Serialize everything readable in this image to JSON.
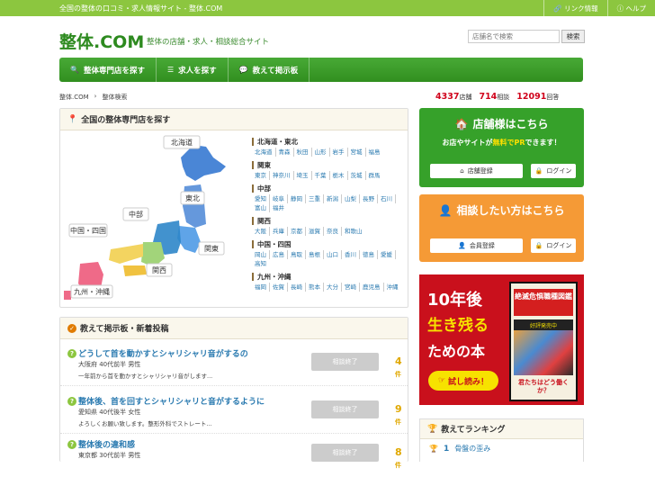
{
  "topbar": {
    "tagline": "全国の整体の口コミ・求人情報サイト - 整体.COM",
    "links": [
      {
        "icon": "link-icon",
        "label": "リンク情報"
      },
      {
        "icon": "help-icon",
        "label": "ヘルプ"
      }
    ]
  },
  "header": {
    "logo": "整体.COM",
    "subtitle": "整体の店舗・求人・相談総合サイト",
    "search_placeholder": "店舗名で検索",
    "search_button": "検索"
  },
  "nav": [
    {
      "icon": "search-icon",
      "label": "整体専門店を探す"
    },
    {
      "icon": "list-icon",
      "label": "求人を探す"
    },
    {
      "icon": "chat-icon",
      "label": "教えて掲示板"
    }
  ],
  "breadcrumb": [
    "整体.COM",
    "整体検索"
  ],
  "stats": [
    {
      "value": "4337",
      "unit": "店舗"
    },
    {
      "value": "714",
      "unit": "相談"
    },
    {
      "value": "12091",
      "unit": "回答"
    }
  ],
  "map_panel": {
    "title": "全国の整体専門店を探す",
    "map_labels": [
      "北海道",
      "東北",
      "中部",
      "関東",
      "中国・四国",
      "関西",
      "九州・沖縄"
    ],
    "regions": [
      {
        "name": "北海道・東北",
        "prefs": [
          "北海道",
          "青森",
          "秋田",
          "山形",
          "岩手",
          "宮城",
          "福島"
        ]
      },
      {
        "name": "関東",
        "prefs": [
          "東京",
          "神奈川",
          "埼玉",
          "千葉",
          "栃木",
          "茨城",
          "群馬"
        ]
      },
      {
        "name": "中部",
        "prefs": [
          "愛知",
          "岐阜",
          "静岡",
          "三重",
          "新潟",
          "山梨",
          "長野",
          "石川",
          "富山",
          "福井"
        ]
      },
      {
        "name": "関西",
        "prefs": [
          "大阪",
          "兵庫",
          "京都",
          "滋賀",
          "奈良",
          "和歌山"
        ]
      },
      {
        "name": "中国・四国",
        "prefs": [
          "岡山",
          "広島",
          "鳥取",
          "島根",
          "山口",
          "香川",
          "徳島",
          "愛媛",
          "高知"
        ]
      },
      {
        "name": "九州・沖縄",
        "prefs": [
          "福岡",
          "佐賀",
          "長崎",
          "熊本",
          "大分",
          "宮崎",
          "鹿児島",
          "沖縄"
        ]
      }
    ]
  },
  "bbs_panel": {
    "title": "教えて掲示板・新着投稿",
    "threads": [
      {
        "title": "どうして首を動かすとシャリシャリ音がするの",
        "meta": "大阪府 40代前半 男性",
        "excerpt": "一年前から首を動かすとシャリシャリ音がします...",
        "status": "相談終了",
        "count": "4",
        "unit": "件"
      },
      {
        "title": "整体後、首を回すとシャリシャリと音がするように",
        "meta": "愛知県 40代後半 女性",
        "excerpt": "よろしくお願い致します。整形外科でストレート...",
        "status": "相談終了",
        "count": "9",
        "unit": "件"
      },
      {
        "title": "整体後の違和感",
        "meta": "東京都 30代前半 男性",
        "excerpt": "",
        "status": "相談終了",
        "count": "8",
        "unit": "件"
      }
    ]
  },
  "cta_shop": {
    "title": "店舗様はこちら",
    "text_pre": "お店やサイトが",
    "text_hl": "無料でPR",
    "text_post": "できます！",
    "btn1": "店舗登録",
    "btn2": "ログイン"
  },
  "cta_consult": {
    "title": "相談したい方はこちら",
    "btn1": "会員登録",
    "btn2": "ログイン"
  },
  "ad": {
    "line1": "10年後",
    "line2": "生き残る",
    "line3": "ための本",
    "try": "試し読み！",
    "book_title": "絶滅危惧職種図鑑",
    "book_band": "好評発売中",
    "book_question": "君たちはどう働くか？"
  },
  "ranking": {
    "title": "教えてランキング",
    "item": {
      "rank": "1",
      "label": "骨盤の歪み"
    }
  },
  "colors": {
    "green": "#8cc63f",
    "dark_green": "#36a12a",
    "orange": "#f59a36",
    "red": "#c9101c",
    "link": "#2a7ab0"
  }
}
